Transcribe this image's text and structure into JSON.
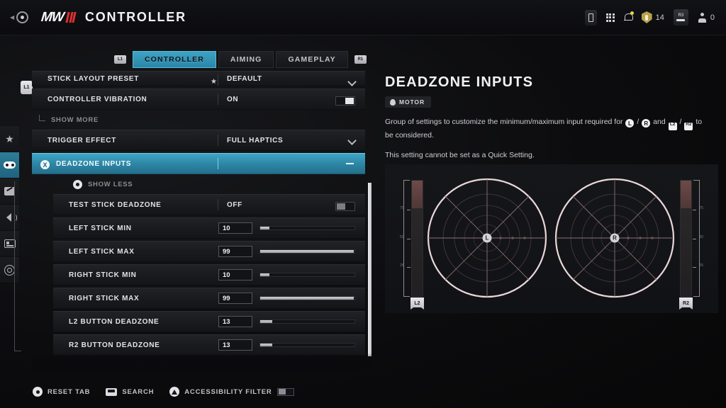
{
  "header": {
    "back_label": "back",
    "logo_text": "MW",
    "title": "CONTROLLER",
    "status": {
      "battery_icon": "battery-icon",
      "apps_icon": "grid-apps-icon",
      "notifications_icon": "bell-icon",
      "shield_count": "14",
      "key_label": "R3",
      "player_count": "0"
    }
  },
  "sidebar": {
    "items": [
      {
        "name": "favorites",
        "icon": "star-icon"
      },
      {
        "name": "controller",
        "icon": "gamepad-icon",
        "active": true
      },
      {
        "name": "graphics",
        "icon": "display-pencil-icon"
      },
      {
        "name": "audio",
        "icon": "speaker-icon"
      },
      {
        "name": "account",
        "icon": "id-card-icon"
      },
      {
        "name": "accessibility",
        "icon": "accessibility-icon"
      }
    ],
    "bumper_badge": "L1"
  },
  "tabs": {
    "left_bumper": "L1",
    "right_bumper": "R1",
    "items": [
      {
        "label": "CONTROLLER",
        "active": true
      },
      {
        "label": "AIMING",
        "active": false
      },
      {
        "label": "GAMEPLAY",
        "active": false
      }
    ]
  },
  "settings": {
    "rows": [
      {
        "label": "STICK LAYOUT PRESET",
        "value": "DEFAULT",
        "control": "dropdown",
        "starred": true,
        "clipped": true
      },
      {
        "label": "CONTROLLER VIBRATION",
        "value": "ON",
        "control": "toggle",
        "toggle_state": "on"
      }
    ],
    "show_more": "SHOW MORE",
    "trigger_effect": {
      "label": "TRIGGER EFFECT",
      "value": "FULL HAPTICS",
      "control": "dropdown"
    },
    "selected_group": {
      "label": "DEADZONE INPUTS",
      "button_hint": "X",
      "collapse_icon": "minus-icon"
    },
    "show_less": "SHOW LESS",
    "sub_rows": [
      {
        "label": "TEST STICK DEADZONE",
        "value": "OFF",
        "control": "toggle",
        "toggle_state": "off"
      },
      {
        "label": "LEFT STICK MIN",
        "value": "10",
        "control": "slider",
        "percent": 10
      },
      {
        "label": "LEFT STICK MAX",
        "value": "99",
        "control": "slider",
        "percent": 99
      },
      {
        "label": "RIGHT STICK MIN",
        "value": "10",
        "control": "slider",
        "percent": 10
      },
      {
        "label": "RIGHT STICK MAX",
        "value": "99",
        "control": "slider",
        "percent": 99
      },
      {
        "label": "L2 BUTTON DEADZONE",
        "value": "13",
        "control": "slider",
        "percent": 13
      },
      {
        "label": "R2 BUTTON DEADZONE",
        "value": "13",
        "control": "slider",
        "percent": 13
      }
    ]
  },
  "detail": {
    "title": "DEADZONE INPUTS",
    "badge": "MOTOR",
    "badge_icon": "flame-icon",
    "description_part1": "Group of settings to customize the minimum/maximum input required for",
    "inline_left_stick": "L",
    "inline_sep1": "/",
    "inline_right_stick": "R",
    "inline_and": "and",
    "inline_l2": "L2",
    "inline_sep2": "/",
    "inline_r2": "R2",
    "description_part2": "to be considered.",
    "note": "This setting cannot be set as a Quick Setting."
  },
  "visualizer": {
    "left_stick_label": "L",
    "right_stick_label": "R",
    "left_trigger_label": "L2",
    "right_trigger_label": "R2",
    "scale_ticks": [
      "75",
      "50",
      "25"
    ]
  },
  "bottombar": {
    "reset_tab": "RESET TAB",
    "search": "SEARCH",
    "accessibility_filter": "ACCESSIBILITY FILTER"
  },
  "colors": {
    "accent": "#3fa6c6",
    "brand_red": "#e03030",
    "panel": "#191a1e",
    "stick_ring": "#e7d5d6"
  }
}
